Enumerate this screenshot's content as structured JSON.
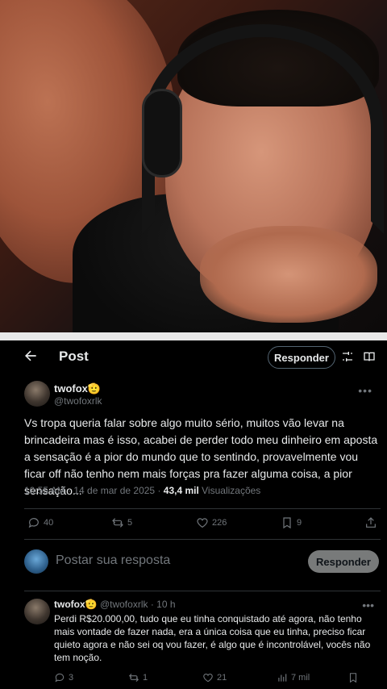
{
  "header": {
    "title": "Post",
    "reply_button": "Responder"
  },
  "post": {
    "author_name": "twofox🫡",
    "author_handle": "@twofoxrlk",
    "text": "Vs tropa queria falar sobre algo muito sério, muitos vão levar na brincadeira mas é isso, acabei de perder todo meu dinheiro em aposta a sensação é a pior do mundo que to sentindo, provavelmente vou ficar off não tenho nem mais forças pra fazer alguma coisa, a pior sensação...",
    "timestamp": "10:55 AM · 14 de mar de 2025 · ",
    "views_count": "43,4 mil",
    "views_label": " Visualizações",
    "stats": {
      "replies": "40",
      "reposts": "5",
      "likes": "226",
      "bookmarks": "9"
    }
  },
  "composer": {
    "placeholder": "Postar sua resposta",
    "button": "Responder"
  },
  "reply": {
    "author_name": "twofox🫡",
    "author_handle": "@twofoxrlk",
    "time": " · 10 h",
    "text": "Perdi R$20.000,00, tudo que eu tinha conquistado até agora, não tenho mais vontade de fazer nada, era a única coisa que eu tinha, preciso ficar quieto agora e não sei oq vou fazer, é algo que é incontrolável, vocês não tem noção.",
    "stats": {
      "replies": "3",
      "reposts": "1",
      "likes": "21",
      "views": "7 mil"
    }
  },
  "icons": {
    "back": "arrow-left-icon",
    "filter": "sliders-icon",
    "reader": "book-icon",
    "more": "more-horizontal-icon",
    "reply": "comment-icon",
    "repost": "repost-icon",
    "like": "heart-icon",
    "bookmark": "bookmark-icon",
    "share": "share-icon",
    "views": "analytics-icon"
  },
  "colors": {
    "background": "#000000",
    "text": "#e7e9ea",
    "muted": "#71767b",
    "divider": "#2f3336"
  }
}
